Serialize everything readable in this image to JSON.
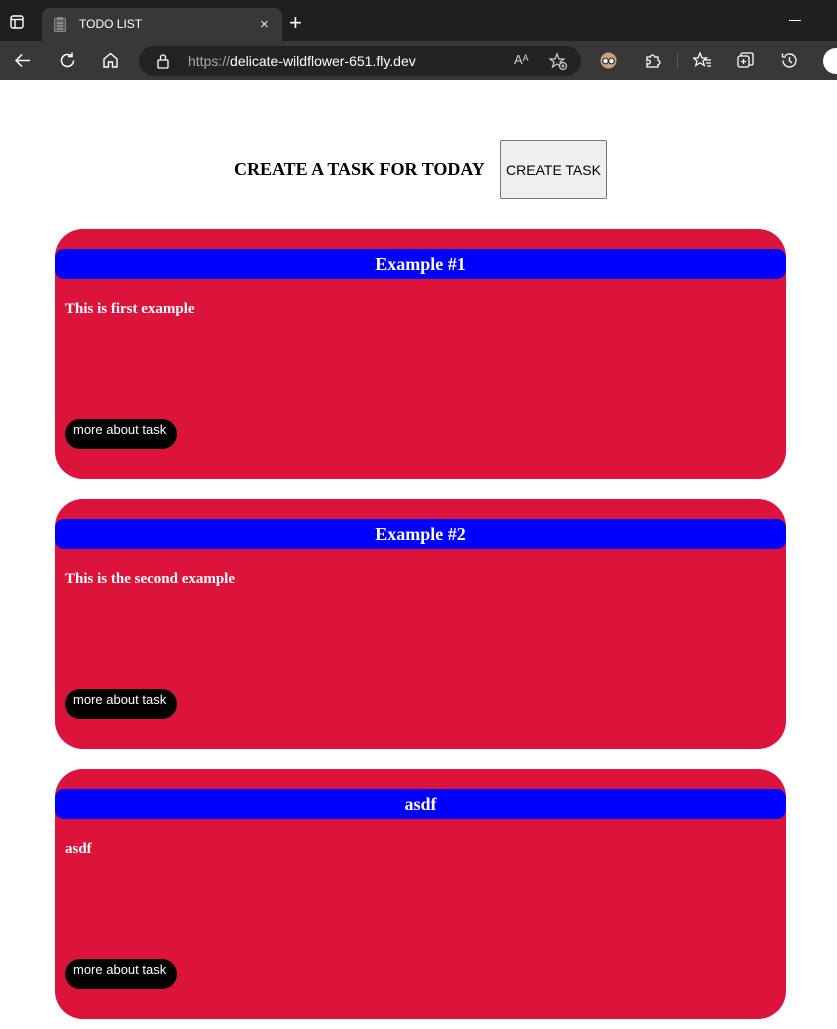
{
  "browser": {
    "tab_title": "TODO LIST",
    "tab_close": "×",
    "new_tab": "+",
    "url_scheme": "https://",
    "url_host": "delicate-wildflower-651.fly.dev",
    "read_aloud": "Aᴬ"
  },
  "header": {
    "title": "CREATE A TASK FOR TODAY",
    "create_button": "CREATE TASK"
  },
  "tasks": [
    {
      "title": "Example #1",
      "description": "This is first example",
      "button": "more about task"
    },
    {
      "title": "Example #2",
      "description": "This is the second example",
      "button": "more about task"
    },
    {
      "title": "asdf",
      "description": "asdf",
      "button": "more about task"
    }
  ],
  "colors": {
    "card_bg": "#dc143c",
    "card_title_bg": "#0000ff",
    "button_bg": "#000000"
  }
}
